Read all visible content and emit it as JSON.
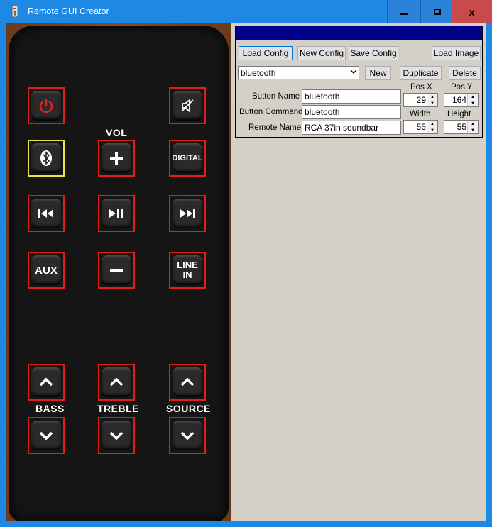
{
  "window": {
    "title": "Remote GUI Creator",
    "minimize_icon": "minimize-icon",
    "maximize_icon": "maximize-icon",
    "close_glyph": "x"
  },
  "toolbar": {
    "load_config": "Load Config",
    "new_config": "New Config",
    "save_config": "Save Config",
    "load_image": "Load Image"
  },
  "button_selector": {
    "selected": "bluetooth",
    "new_label": "New",
    "duplicate_label": "Duplicate",
    "delete_label": "Delete"
  },
  "fields": {
    "button_name_label": "Button Name",
    "button_name_value": "bluetooth",
    "button_command_label": "Button Command",
    "button_command_value": "bluetooth",
    "remote_name_label": "Remote Name",
    "remote_name_value": "RCA 37in soundbar",
    "pos_x_label": "Pos X",
    "pos_x_value": "29",
    "pos_y_label": "Pos Y",
    "pos_y_value": "164",
    "width_label": "Width",
    "width_value": "55",
    "height_label": "Height",
    "height_value": "55"
  },
  "remote": {
    "labels": {
      "vol": "VOL",
      "bass": "BASS",
      "treble": "TREBLE",
      "source": "SOURCE"
    },
    "buttons": {
      "digital": "DIGITAL",
      "aux": "AUX",
      "line_in": "LINE IN"
    }
  },
  "colors": {
    "titlebar": "#1e88e5",
    "close_button": "#c94a4a",
    "panel_header": "#00008b",
    "button_outline": "#e21b1b",
    "selected_outline": "#e8e34a"
  }
}
